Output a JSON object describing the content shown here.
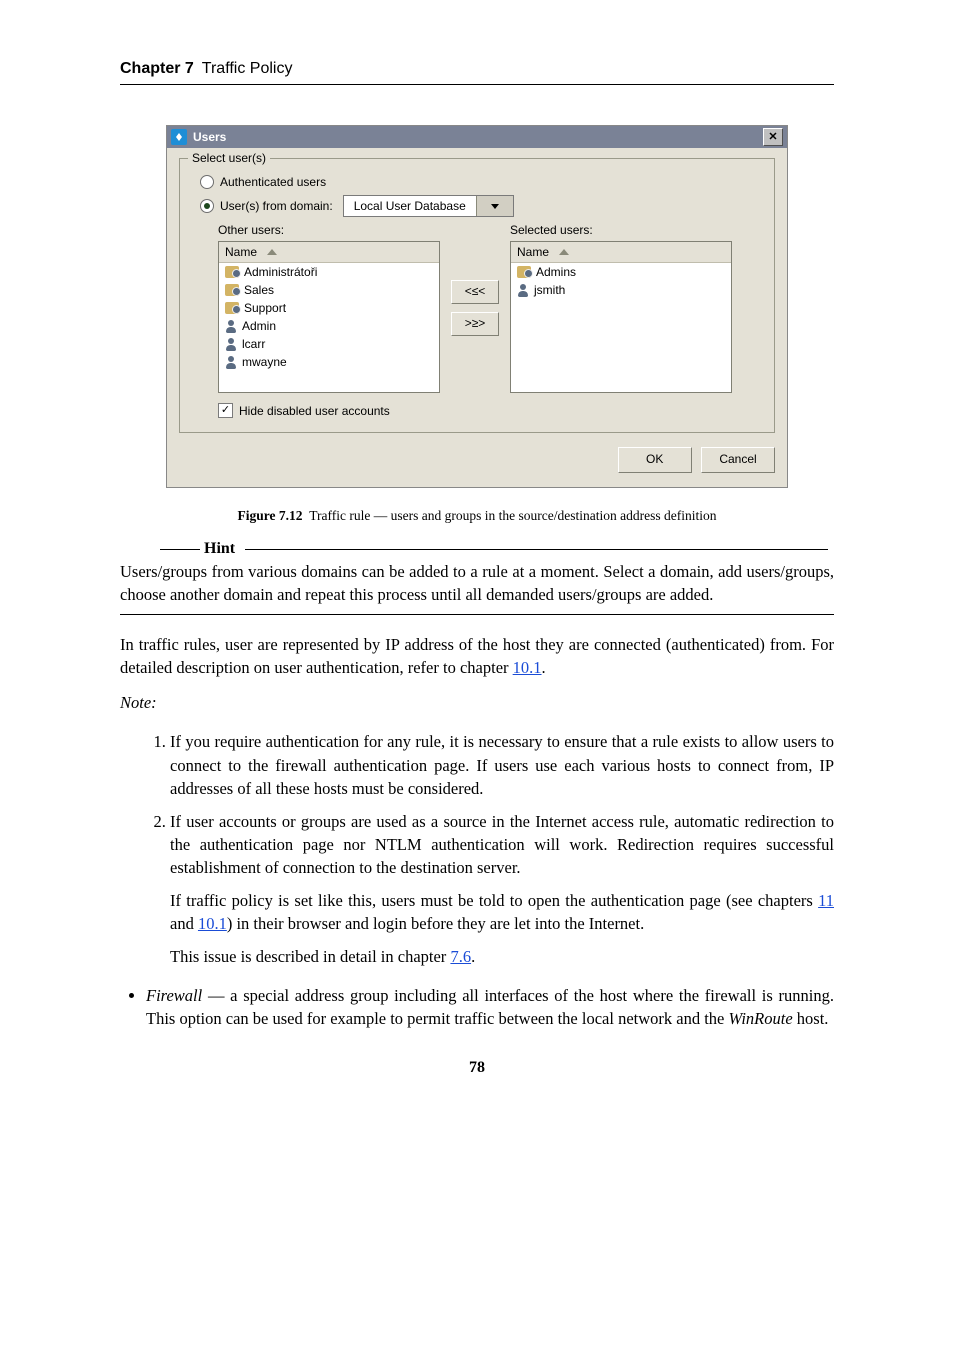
{
  "chapter": {
    "label": "Chapter 7",
    "title": "Traffic Policy"
  },
  "dialog": {
    "title": "Users",
    "group_legend": "Select user(s)",
    "radio_auth": "Authenticated users",
    "radio_domain": "User(s) from domain:",
    "domain_value": "Local User Database",
    "other_users_label": "Other users:",
    "selected_users_label": "Selected users:",
    "col_header": "Name",
    "left_items": [
      {
        "t": "Administrátoři",
        "icon": "group"
      },
      {
        "t": "Sales",
        "icon": "group"
      },
      {
        "t": "Support",
        "icon": "group"
      },
      {
        "t": "Admin",
        "icon": "user"
      },
      {
        "t": "lcarr",
        "icon": "user"
      },
      {
        "t": "mwayne",
        "icon": "user"
      }
    ],
    "right_items": [
      {
        "t": "Admins",
        "icon": "group"
      },
      {
        "t": "jsmith",
        "icon": "user"
      }
    ],
    "btn_add": "<≤<",
    "btn_remove": ">≥>",
    "hide_disabled": "Hide disabled user accounts",
    "ok": "OK",
    "cancel": "Cancel"
  },
  "caption": {
    "label": "Figure 7.12",
    "text": "Traffic rule — users and groups in the source/destination address definition"
  },
  "hint": {
    "label": "Hint",
    "text": "Users/groups from various domains can be added to a rule at a moment. Select a domain, add users/groups, choose another domain and repeat this process until all demanded users/groups are added."
  },
  "para_traffic": {
    "t1": "In traffic rules, user are represented by IP address of the host they are connected (authenticated) from. For detailed description on user authentication, refer to chapter ",
    "link": "10.1",
    "t2": "."
  },
  "note_label": "Note:",
  "notes": {
    "n1": "If you require authentication for any rule, it is necessary to ensure that a rule exists to allow users to connect to the firewall authentication page. If users use each various hosts to connect from, IP addresses of all these hosts must be considered.",
    "n2a": "If user accounts or groups are used as a source in the Internet access rule, automatic redirection to the authentication page nor NTLM authentication will work. Redirection requires successful establishment of connection to the destination server.",
    "n2b_1": "If traffic policy is set like this, users must be told to open the authentication page (see chapters ",
    "n2b_l1": "11",
    "n2b_m": " and ",
    "n2b_l2": "10.1",
    "n2b_2": ") in their browser and login before they are let into the Internet.",
    "n2c_1": "This issue is described in detail in chapter ",
    "n2c_l": "7.6",
    "n2c_2": "."
  },
  "bullet": {
    "firewall_label": "Firewall",
    "firewall_text": " — a special address group including all interfaces of the host where the firewall is running.  This option can be used for example to permit traffic between the local network and the ",
    "winroute": "WinRoute",
    "tail": " host."
  },
  "pagenum": "78"
}
